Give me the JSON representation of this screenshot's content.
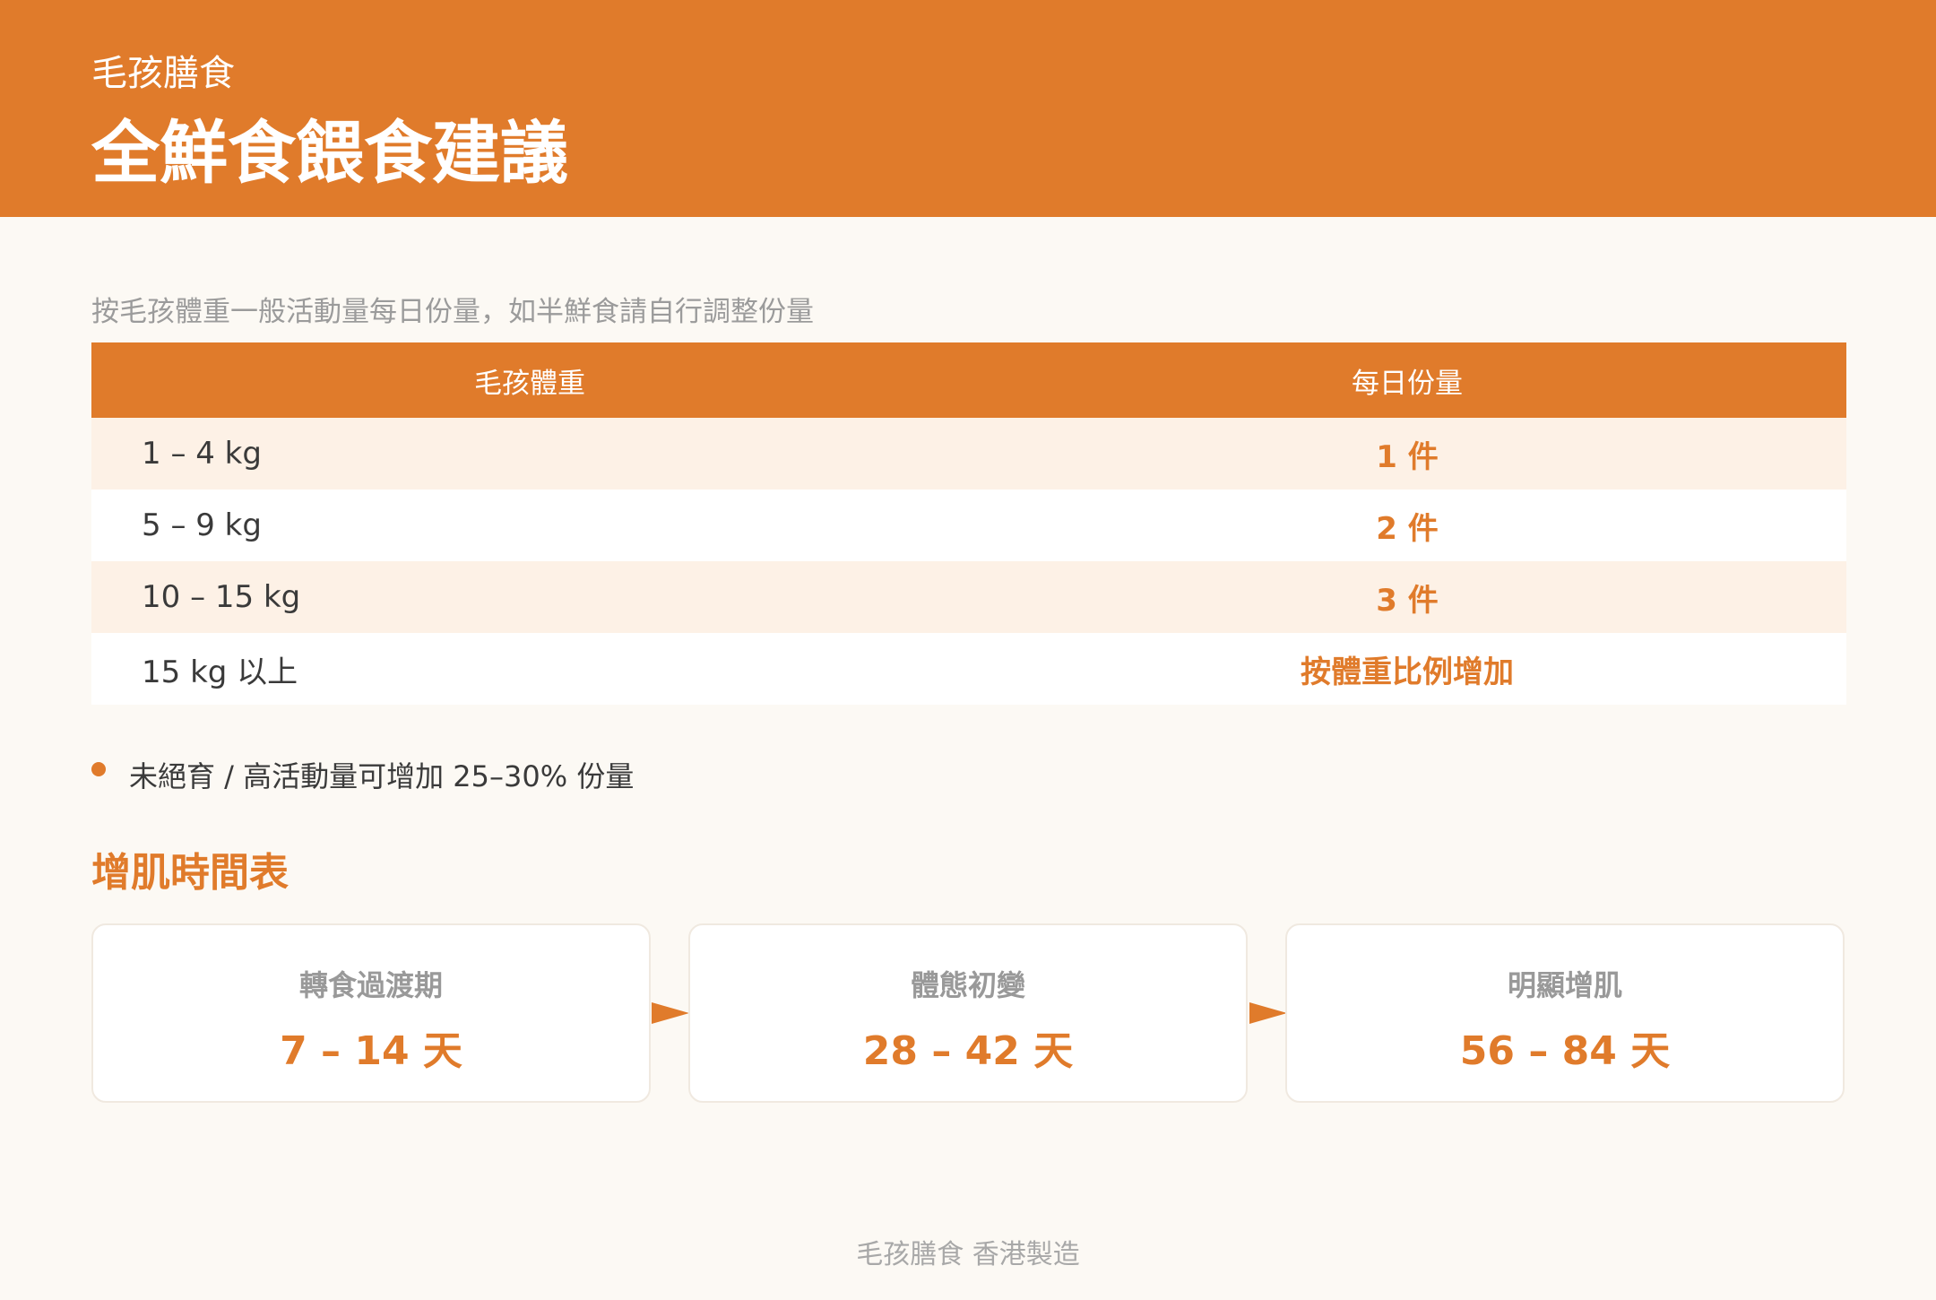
{
  "header": {
    "brand": "毛孩膳食",
    "title": "全鮮食餵食建議"
  },
  "subtitle": "按毛孩體重一般活動量每日份量，如半鮮食請自行調整份量",
  "table": {
    "headers": [
      "毛孩體重",
      "每日份量"
    ],
    "rows": [
      {
        "weight": "1 – 4 kg",
        "portion": "1 件"
      },
      {
        "weight": "5 – 9 kg",
        "portion": "2 件"
      },
      {
        "weight": "10 – 15 kg",
        "portion": "3 件"
      },
      {
        "weight": "15 kg 以上",
        "portion": "按體重比例增加"
      }
    ]
  },
  "note": "未絕育 / 高活動量可增加 25–30% 份量",
  "timeline": {
    "title": "增肌時間表",
    "stages": [
      {
        "label": "轉食過渡期",
        "value": "7 – 14 天"
      },
      {
        "label": "體態初變",
        "value": "28 – 42 天"
      },
      {
        "label": "明顯增肌",
        "value": "56 – 84 天"
      }
    ]
  },
  "footer": "毛孩膳食 香港製造",
  "colors": {
    "accent": "#e07b2b",
    "background": "#fcf9f4",
    "row_alt": "#fdf1e6"
  }
}
